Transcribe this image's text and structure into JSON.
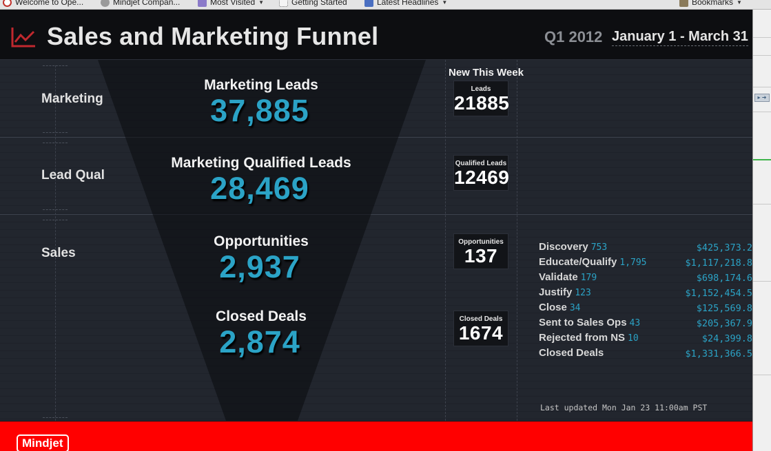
{
  "browser": {
    "bookmarks": [
      {
        "label": "Welcome to Ope...",
        "icon": "opera-icon",
        "color": "#c0312b",
        "has_caret": false
      },
      {
        "label": "Mindjet Compan...",
        "icon": "globe-icon",
        "color": "#777777",
        "has_caret": false
      },
      {
        "label": "Most Visited",
        "icon": "folder-icon",
        "color": "#8b7ac9",
        "has_caret": true
      },
      {
        "label": "Getting Started",
        "icon": "page-icon",
        "color": "#dddddd",
        "has_caret": false
      },
      {
        "label": "Latest Headlines",
        "icon": "rss-icon",
        "color": "#4a6fc1",
        "has_caret": true
      },
      {
        "label": "Bookmarks",
        "icon": "bookmarks-icon",
        "color": "#8a7a5a",
        "has_caret": true
      }
    ]
  },
  "header": {
    "title": "Sales and Marketing Funnel",
    "quarter": "Q1 2012",
    "date_range": "January 1 - March 31",
    "icon": "line-chart-icon",
    "icon_color": "#c0282e"
  },
  "rows": {
    "marketing": "Marketing",
    "lead_qual": "Lead Qual",
    "sales": "Sales"
  },
  "funnel": {
    "marketing_leads": {
      "label": "Marketing Leads",
      "value": "37,885"
    },
    "qualified_leads": {
      "label": "Marketing Qualified Leads",
      "value": "28,469"
    },
    "opportunities": {
      "label": "Opportunities",
      "value": "2,937"
    },
    "closed_deals": {
      "label": "Closed Deals",
      "value": "2,874"
    }
  },
  "new_this_week": {
    "title": "New This Week",
    "leads": {
      "label": "Leads",
      "value": "21885"
    },
    "qualified_leads": {
      "label": "Qualified Leads",
      "value": "12469"
    },
    "opportunities": {
      "label": "Opportunities",
      "value": "137"
    },
    "closed_deals": {
      "label": "Closed Deals",
      "value": "1674"
    }
  },
  "stages": [
    {
      "name": "Discovery",
      "count": "753",
      "amount": "$425,373.2"
    },
    {
      "name": "Educate/Qualify",
      "count": "1,795",
      "amount": "$1,117,218.8"
    },
    {
      "name": "Validate",
      "count": "179",
      "amount": "$698,174.6"
    },
    {
      "name": "Justify",
      "count": "123",
      "amount": "$1,152,454.5"
    },
    {
      "name": "Close",
      "count": "34",
      "amount": "$125,569.8"
    },
    {
      "name": "Sent to Sales Ops",
      "count": "43",
      "amount": "$205,367.9"
    },
    {
      "name": "Rejected from NS",
      "count": "10",
      "amount": "$24,399.8"
    },
    {
      "name": "Closed Deals",
      "count": "",
      "amount": "$1,331,366.5"
    }
  ],
  "last_updated": "Last updated Mon Jan 23 11:00am PST",
  "footer": {
    "logo_text": "Mindjet"
  },
  "colors": {
    "accent": "#2ba3c6",
    "footer_red": "#ff0000",
    "background": "#1a1d24"
  }
}
